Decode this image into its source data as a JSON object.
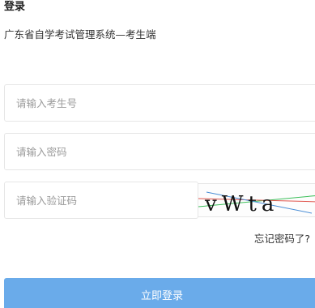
{
  "heading": "登录",
  "system_name": "广东省自学考试管理系统—考生端",
  "form": {
    "username_placeholder": "请输入考生号",
    "password_placeholder": "请输入密码",
    "captcha_placeholder": "请输入验证码",
    "captcha_text": "vWta"
  },
  "forgot_password": "忘记密码了?",
  "login_button": "立即登录",
  "colors": {
    "button_background": "#6aabea",
    "captcha_noise_green": "#3cbf5a",
    "captcha_noise_red": "#e0554d",
    "captcha_noise_blue": "#4a8ed6"
  }
}
